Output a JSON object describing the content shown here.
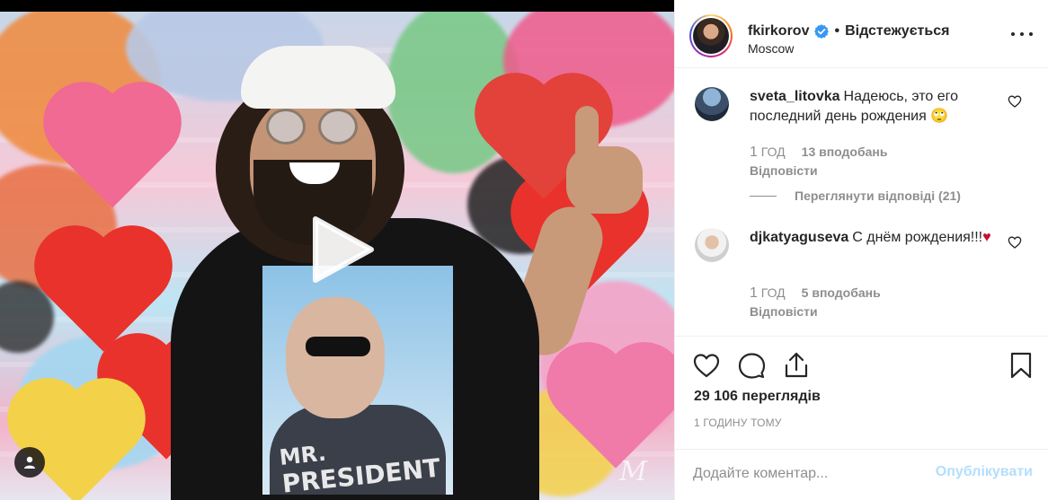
{
  "colors": {
    "verified": "#3897f0",
    "muted_text": "#8e8e8e",
    "heart_emoji": "#c8102e",
    "publish_disabled": "#b2dffc",
    "border": "#efefef"
  },
  "media": {
    "type": "video",
    "shirt_print_line1": "MR.",
    "shirt_print_line2": "PRESIDENT",
    "watermark": "M"
  },
  "header": {
    "username": "fkirkorov",
    "verified": true,
    "separator": "•",
    "follow_label": "Відстежується",
    "location": "Moscow"
  },
  "comments": [
    {
      "username": "sveta_litovka",
      "text": "Надеюсь, это его последний день рождения 🙄",
      "time_number": "1",
      "time_unit": "ГОД",
      "likes": "13 вподобань",
      "reply_label": "Відповісти",
      "view_replies": "Переглянути відповіді (21)"
    },
    {
      "username": "djkatyaguseva",
      "text": "С днём рождения!!!",
      "emoji": "♥",
      "time_number": "1",
      "time_unit": "ГОД",
      "likes": "5 вподобань",
      "reply_label": "Відповісти"
    }
  ],
  "stats": {
    "views": "29 106 переглядів",
    "time_ago": "1 ГОДИНУ ТОМУ"
  },
  "add_comment": {
    "placeholder": "Додайте коментар...",
    "value": "",
    "publish_label": "Опублікувати"
  },
  "icons": {
    "like": "heart-icon",
    "comment": "comment-icon",
    "share": "share-icon",
    "save": "bookmark-icon",
    "options": "more-options-icon",
    "play": "play-icon",
    "tags": "user-tag-icon"
  }
}
